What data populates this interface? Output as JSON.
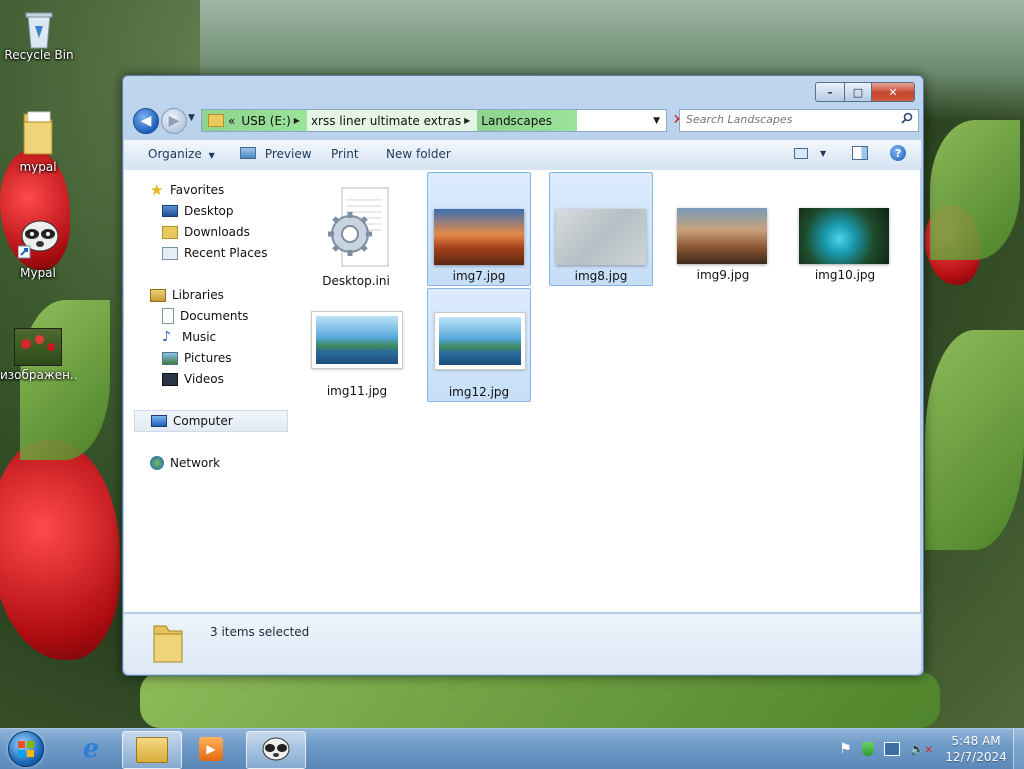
{
  "desktop": {
    "icons": [
      {
        "label": "Recycle Bin",
        "icon": "recycle-bin-icon"
      },
      {
        "label": "mypal",
        "icon": "folder-icon"
      },
      {
        "label": "Mypal",
        "icon": "mypal-raccoon-icon"
      },
      {
        "label": "изображен...",
        "icon": "image-file-icon"
      }
    ]
  },
  "window": {
    "caption_buttons": {
      "minimize": "–",
      "maximize": "□",
      "close": "✕"
    },
    "nav": {
      "back": "◀",
      "forward": "▶",
      "history": "▼"
    },
    "address": {
      "overflow": "«",
      "segments": [
        "USB (E:)",
        "xrss liner ultimate extras",
        "Landscapes"
      ],
      "clear": "✕"
    },
    "search": {
      "placeholder": "Search Landscapes",
      "value": ""
    },
    "toolbar": {
      "organize": "Organize",
      "preview": "Preview",
      "print": "Print",
      "new_folder": "New folder"
    },
    "nav_pane": {
      "favorites": "Favorites",
      "favorites_items": [
        "Desktop",
        "Downloads",
        "Recent Places"
      ],
      "libraries": "Libraries",
      "libraries_items": [
        "Documents",
        "Music",
        "Pictures",
        "Videos"
      ],
      "computer": "Computer",
      "network": "Network"
    },
    "files": [
      {
        "name": "Desktop.ini",
        "selected": false,
        "kind": "settings-file"
      },
      {
        "name": "img7.jpg",
        "selected": true,
        "kind": "image"
      },
      {
        "name": "img8.jpg",
        "selected": true,
        "kind": "image"
      },
      {
        "name": "img9.jpg",
        "selected": false,
        "kind": "image"
      },
      {
        "name": "img10.jpg",
        "selected": false,
        "kind": "image"
      },
      {
        "name": "img11.jpg",
        "selected": false,
        "kind": "image"
      },
      {
        "name": "img12.jpg",
        "selected": true,
        "kind": "image"
      }
    ],
    "details": {
      "status": "3 items selected"
    }
  },
  "taskbar": {
    "clock": {
      "time": "5:48 AM",
      "date": "12/7/2024"
    }
  },
  "colors": {
    "selection": "#c6def8",
    "address_highlight": "#9be39b",
    "taskbar": "#6e9bc8"
  }
}
